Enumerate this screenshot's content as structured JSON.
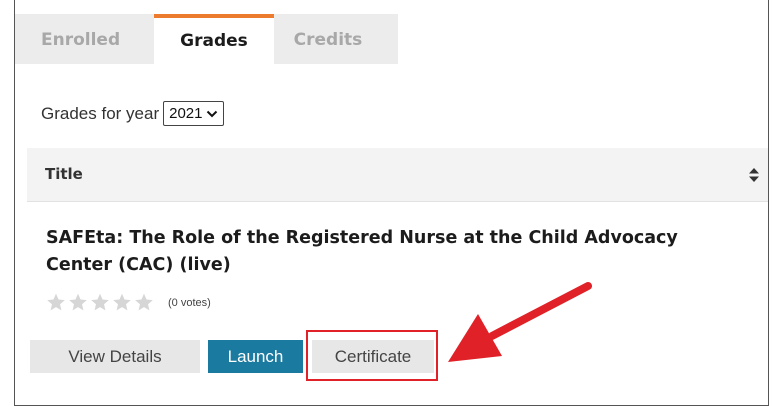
{
  "tabs": [
    {
      "label": "Enrolled",
      "active": false
    },
    {
      "label": "Grades",
      "active": true
    },
    {
      "label": "Credits",
      "active": false
    }
  ],
  "colors": {
    "accent": "#ec7b2d",
    "launch": "#1a7aa0",
    "highlight": "#e02127"
  },
  "year_filter": {
    "label": "Grades for year",
    "selected": "2021"
  },
  "table": {
    "header_title": "Title",
    "sort_icon": "sort-icon"
  },
  "course": {
    "title": "SAFEta: The Role of the Registered Nurse at the Child Advocacy Center (CAC) (live)",
    "rating_stars": 0,
    "rating_max": 5,
    "votes": "(0 votes)"
  },
  "buttons": {
    "view_details": "View Details",
    "launch": "Launch",
    "certificate": "Certificate"
  }
}
